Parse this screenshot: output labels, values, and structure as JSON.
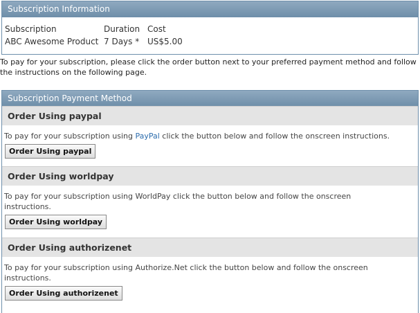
{
  "info_panel": {
    "title": "Subscription Information",
    "columns": [
      "Subscription",
      "Duration",
      "Cost"
    ],
    "row": {
      "subscription": "ABC Awesome Product",
      "duration": "7 Days *",
      "cost": "US$5.00"
    }
  },
  "intro_text": "To pay for your subscription, please click the order button next to your preferred payment method and follow the instructions on the following page.",
  "payment_panel": {
    "title": "Subscription Payment Method",
    "methods": [
      {
        "heading": "Order Using paypal",
        "desc_before": "To pay for your subscription using ",
        "desc_link": "PayPal",
        "desc_after": " click the button below and follow the onscreen instructions.",
        "button": "Order Using paypal"
      },
      {
        "heading": "Order Using worldpay",
        "desc_line1": "To pay for your subscription using WorldPay click the button below and follow the onscreen",
        "desc_line2": "instructions.",
        "button": "Order Using worldpay"
      },
      {
        "heading": "Order Using authorizenet",
        "desc_line1": "To pay for your subscription using Authorize.Net click the button below and follow the onscreen",
        "desc_line2": "instructions.",
        "button": "Order Using authorizenet"
      }
    ]
  }
}
